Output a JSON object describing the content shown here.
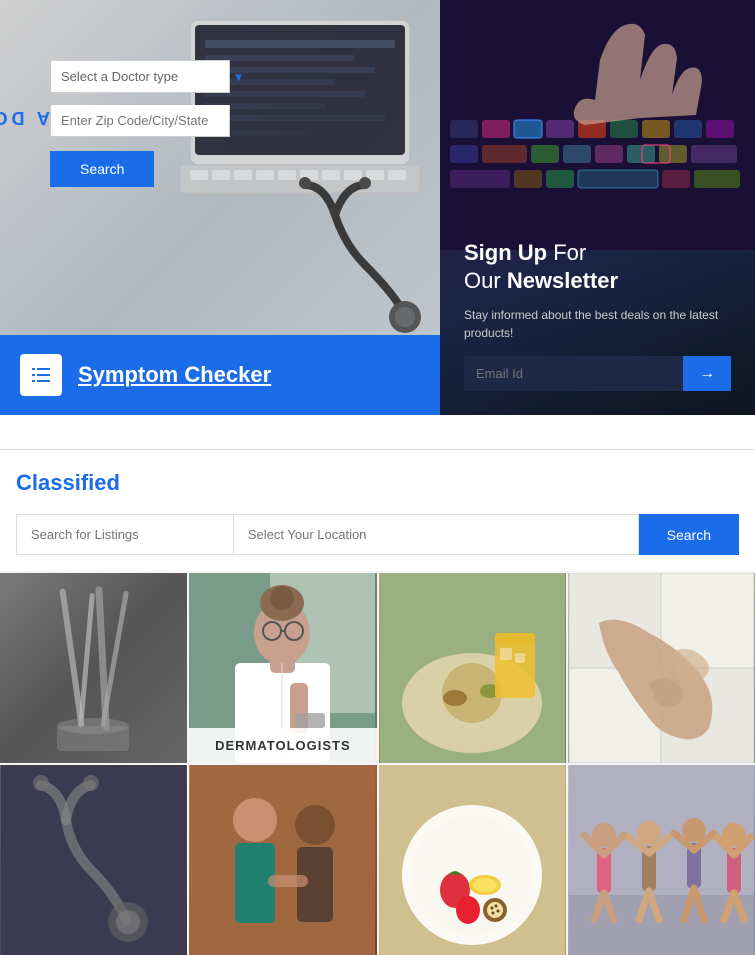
{
  "findDoctor": {
    "verticalText": "FIND A DOCTOR",
    "selectPlaceholder": "Select a Doctor type",
    "zipPlaceholder": "Enter Zip Code/City/State",
    "searchLabel": "Search"
  },
  "symptomChecker": {
    "label": "Symptom Checker"
  },
  "newsletter": {
    "signupLabel": "Sign Up",
    "forText": "For",
    "ourText": "Our",
    "newsletterText": "Newsletter",
    "description": "Stay informed about the best deals on the latest products!",
    "emailPlaceholder": "Email Id",
    "submitArrow": "→"
  },
  "classified": {
    "title": "Classified",
    "listingPlaceholder": "Search for Listings",
    "locationPlaceholder": "Select Your Location",
    "searchLabel": "Search"
  },
  "imageGrid": {
    "dermatologistLabel": "DERMATOLOGISTS",
    "cells": [
      {
        "id": 1,
        "label": ""
      },
      {
        "id": 2,
        "label": "DERMATOLOGISTS"
      },
      {
        "id": 3,
        "label": ""
      },
      {
        "id": 4,
        "label": ""
      },
      {
        "id": 5,
        "label": ""
      },
      {
        "id": 6,
        "label": ""
      },
      {
        "id": 7,
        "label": ""
      },
      {
        "id": 8,
        "label": ""
      }
    ]
  }
}
